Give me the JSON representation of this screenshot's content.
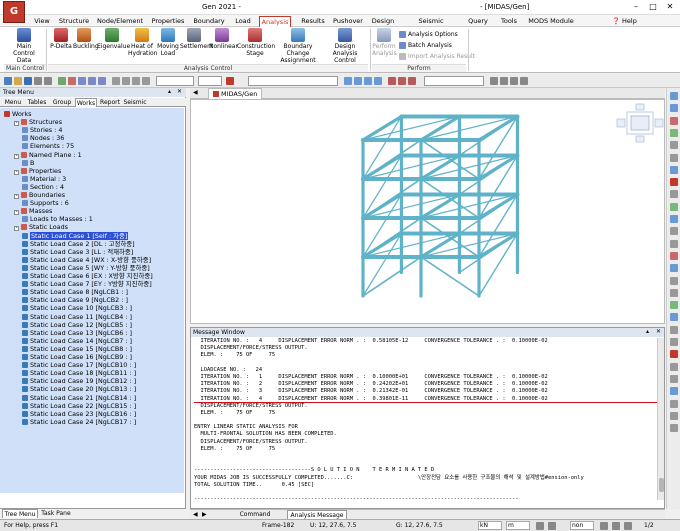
{
  "window": {
    "app_title": "Gen 2021 -",
    "doc_title": "- [MIDAS/Gen]",
    "logo": "G"
  },
  "menu_tabs": [
    "View",
    "Structure",
    "Node/Element",
    "Properties",
    "Boundary",
    "Load",
    "Analysis",
    "Results",
    "Pushover",
    "Design",
    "Seismic Evaluation",
    "Query",
    "Tools",
    "MODS Module"
  ],
  "active_menu_tab": "Analysis",
  "help_label": "Help",
  "ribbon": {
    "buttons": [
      {
        "label": "Main Control Data"
      },
      {
        "label": "P-Delta"
      },
      {
        "label": "Buckling"
      },
      {
        "label": "Eigenvalue"
      },
      {
        "label": "Heat of Hydration"
      },
      {
        "label": "Moving Load"
      },
      {
        "label": "Settlement"
      },
      {
        "label": "Nonlinear"
      },
      {
        "label": "Construction Stage"
      },
      {
        "label": "Boundary Change Assignment"
      },
      {
        "label": "Design Analysis Control"
      },
      {
        "label": "Perform Analysis"
      }
    ],
    "options": [
      "Analysis Options",
      "Batch Analysis",
      "Import Analysis Result"
    ],
    "groups": [
      "Main Control",
      "Analysis Control",
      "Perform"
    ]
  },
  "left_panel": {
    "title": "Tree Menu",
    "tabs": [
      "Menu",
      "Tables",
      "Group",
      "Works",
      "Report",
      "Seismic"
    ],
    "active_tab": "Works",
    "tree": [
      {
        "text": "Works",
        "level": 0
      },
      {
        "text": "Structures",
        "level": 1
      },
      {
        "text": "Stories : 4",
        "level": 2
      },
      {
        "text": "Nodes : 36",
        "level": 2
      },
      {
        "text": "Elements : 75",
        "level": 2
      },
      {
        "text": "Named Plane : 1",
        "level": 1
      },
      {
        "text": "B",
        "level": 2
      },
      {
        "text": "Properties",
        "level": 1
      },
      {
        "text": "Material : 3",
        "level": 2
      },
      {
        "text": "Section : 4",
        "level": 2
      },
      {
        "text": "Boundaries",
        "level": 1
      },
      {
        "text": "Supports : 6",
        "level": 2
      },
      {
        "text": "Masses",
        "level": 1
      },
      {
        "text": "Loads to Masses : 1",
        "level": 2
      },
      {
        "text": "Static Loads",
        "level": 1
      },
      {
        "text": "Static Load Case 1 [Self : 자중]",
        "level": 2,
        "selected": true
      },
      {
        "text": "Static Load Case 2 [DL : 고정하중]",
        "level": 2
      },
      {
        "text": "Static Load Case 3 [LL : 적재하중]",
        "level": 2
      },
      {
        "text": "Static Load Case 4 [WX : X-방향 풍하중]",
        "level": 2
      },
      {
        "text": "Static Load Case 5 [WY : Y-방향 풍하중]",
        "level": 2
      },
      {
        "text": "Static Load Case 6 [EX : X방향 지진하중]",
        "level": 2
      },
      {
        "text": "Static Load Case 7 [EY : Y방향 지진하중]",
        "level": 2
      },
      {
        "text": "Static Load Case 8 [NgLCB1 : ]",
        "level": 2
      },
      {
        "text": "Static Load Case 9 [NgLCB2 : ]",
        "level": 2
      },
      {
        "text": "Static Load Case 10 [NgLCB3 : ]",
        "level": 2
      },
      {
        "text": "Static Load Case 11 [NgLCB4 : ]",
        "level": 2
      },
      {
        "text": "Static Load Case 12 [NgLCB5 : ]",
        "level": 2
      },
      {
        "text": "Static Load Case 13 [NgLCB6 : ]",
        "level": 2
      },
      {
        "text": "Static Load Case 14 [NgLCB7 : ]",
        "level": 2
      },
      {
        "text": "Static Load Case 15 [NgLCB8 : ]",
        "level": 2
      },
      {
        "text": "Static Load Case 16 [NgLCB9 : ]",
        "level": 2
      },
      {
        "text": "Static Load Case 17 [NgLCB10 : ]",
        "level": 2
      },
      {
        "text": "Static Load Case 18 [NgLCB11 : ]",
        "level": 2
      },
      {
        "text": "Static Load Case 19 [NgLCB12 : ]",
        "level": 2
      },
      {
        "text": "Static Load Case 20 [NgLCB13 : ]",
        "level": 2
      },
      {
        "text": "Static Load Case 21 [NgLCB14 : ]",
        "level": 2
      },
      {
        "text": "Static Load Case 22 [NgLCB15 : ]",
        "level": 2
      },
      {
        "text": "Static Load Case 23 [NgLCB16 : ]",
        "level": 2
      },
      {
        "text": "Static Load Case 24 [NgLCB17 : ]",
        "level": 2
      }
    ],
    "bottom_tabs": [
      "Tree Menu",
      "Task Pane"
    ]
  },
  "viewport": {
    "tab_label": "MIDAS/Gen"
  },
  "message_window": {
    "title": "Message Window",
    "lines": [
      "  ITERATION NO. :   4     DISPLACEMENT ERROR NORM . :  0.58105E-12     CONVERGENCE TOLERANCE . :  0.10000E-02",
      "  DISPLACEMENT/FORCE/STRESS OUTPUT.",
      "  ELEM. :    75 OF     75",
      "",
      "  LOADCASE NO. :   24",
      "  ITERATION NO. :   1     DISPLACEMENT ERROR NORM . :  0.10000E+01     CONVERGENCE TOLERANCE . :  0.10000E-02",
      "  ITERATION NO. :   2     DISPLACEMENT ERROR NORM . :  0.24202E+01     CONVERGENCE TOLERANCE . :  0.10000E-02",
      "  ITERATION NO. :   3     DISPLACEMENT ERROR NORM . :  0.21342E-01     CONVERGENCE TOLERANCE . :  0.10000E-02",
      "  ITERATION NO. :   4     DISPLACEMENT ERROR NORM . :  0.39801E-11     CONVERGENCE TOLERANCE . :  0.10000E-02",
      "  DISPLACEMENT/FORCE/STRESS OUTPUT.",
      "  ELEM. :    75 OF     75",
      "",
      "ENTRY LINEAR STATIC ANALYSIS FOR",
      "  MULTI-FRONTAL SOLUTION HAS BEEN COMPLETED.",
      "  DISPLACEMENT/FORCE/STRESS OUTPUT.",
      "  ELEM. :    75 OF     75",
      "",
      "",
      "------------------------------------S O L U T I O N    T E R M I N A T E D",
      "YOUR MIDAS JOB IS SUCCESSFULLY COMPLETED.......C:                    \\안장전담 요소를 사용한 구조물의 해석 및 설계방법#ension-only",
      "TOTAL SOLUTION TIME..      0.45 [SEC]",
      "",
      "----------------------------------------------------------------------------------------------------"
    ],
    "tabs": [
      "Command Message",
      "Analysis Message"
    ],
    "active_tab": "Analysis Message"
  },
  "status_bar": {
    "help_text": "For Help, press F1",
    "frame": "Frame-182",
    "u_coords": "U: 12, 27.6, 7.5",
    "g_coords": "G: 12, 27.6, 7.5",
    "force_unit": "kN",
    "length_unit": "m",
    "mode": "non",
    "page": "1/2"
  },
  "colors": {
    "accent": "#c0392b",
    "tree_bg": "#cfe0f8",
    "selection": "#2b4fd6",
    "frame_color": "#5fb3c8",
    "underline": "#d01020"
  }
}
